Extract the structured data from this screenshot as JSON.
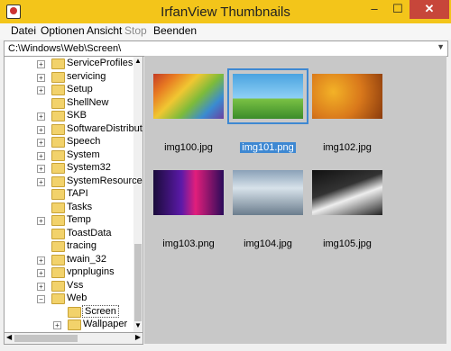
{
  "window": {
    "title": "IrfanView Thumbnails",
    "min_glyph": "–",
    "max_glyph": "☐",
    "close_glyph": "✕"
  },
  "menu": [
    {
      "label": "Datei",
      "enabled": true
    },
    {
      "label": "Optionen",
      "enabled": true
    },
    {
      "label": "Ansicht",
      "enabled": true
    },
    {
      "label": "Stop",
      "enabled": false
    },
    {
      "label": "Beenden",
      "enabled": true
    }
  ],
  "address": {
    "path": "C:\\Windows\\Web\\Screen\\"
  },
  "tree": {
    "items": [
      {
        "label": "ServiceProfiles",
        "expander": "+"
      },
      {
        "label": "servicing",
        "expander": "+"
      },
      {
        "label": "Setup",
        "expander": "+"
      },
      {
        "label": "ShellNew",
        "expander": ""
      },
      {
        "label": "SKB",
        "expander": "+"
      },
      {
        "label": "SoftwareDistributi",
        "expander": "+"
      },
      {
        "label": "Speech",
        "expander": "+"
      },
      {
        "label": "System",
        "expander": "+"
      },
      {
        "label": "System32",
        "expander": "+"
      },
      {
        "label": "SystemResources",
        "expander": "+"
      },
      {
        "label": "TAPI",
        "expander": ""
      },
      {
        "label": "Tasks",
        "expander": ""
      },
      {
        "label": "Temp",
        "expander": "+"
      },
      {
        "label": "ToastData",
        "expander": ""
      },
      {
        "label": "tracing",
        "expander": ""
      },
      {
        "label": "twain_32",
        "expander": "+"
      },
      {
        "label": "vpnplugins",
        "expander": "+"
      },
      {
        "label": "Vss",
        "expander": "+"
      },
      {
        "label": "Web",
        "expander": "−"
      },
      {
        "label": "Screen",
        "expander": "",
        "selected": true
      },
      {
        "label": "Wallpaper",
        "expander": "+"
      }
    ]
  },
  "thumbnails": [
    {
      "filename": "img100.jpg",
      "selected": false
    },
    {
      "filename": "img101.png",
      "selected": true
    },
    {
      "filename": "img102.jpg",
      "selected": false
    },
    {
      "filename": "img103.png",
      "selected": false
    },
    {
      "filename": "img104.jpg",
      "selected": false
    },
    {
      "filename": "img105.jpg",
      "selected": false
    }
  ],
  "colors": {
    "titlebar": "#f3c51a",
    "selection": "#3e88d2",
    "close": "#c7463a"
  }
}
